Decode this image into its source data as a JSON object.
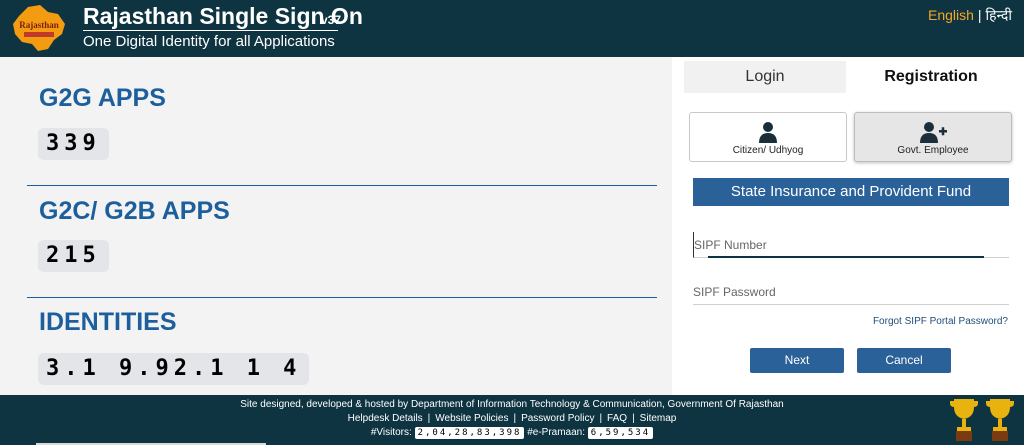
{
  "header": {
    "logo_text": "Rajasthan",
    "title": "Rajasthan Single Sign On",
    "version": "v37",
    "subtitle": "One Digital Identity for all Applications",
    "lang_en": "English",
    "lang_separator": "|",
    "lang_hi": "हिन्दी"
  },
  "stats": [
    {
      "title": "G2G APPS",
      "value": "339"
    },
    {
      "title": "G2C/ G2B APPS",
      "value": "215"
    },
    {
      "title": "IDENTITIES",
      "value": "3.1 9.92.1 1 4"
    }
  ],
  "tabs": {
    "login": "Login",
    "registration": "Registration"
  },
  "user_types": {
    "citizen": "Citizen/ Udhyog",
    "gov": "Govt. Employee"
  },
  "sipf": {
    "heading": "State Insurance and Provident Fund",
    "number_placeholder": "SIPF Number",
    "password_placeholder": "SIPF Password",
    "forgot": "Forgot SIPF Portal Password?"
  },
  "buttons": {
    "next": "Next",
    "cancel": "Cancel"
  },
  "footer": {
    "credit": "Site designed, developed & hosted by Department of Information Technology & Communication, Government Of Rajasthan",
    "links": [
      "Helpdesk Details",
      "Website Policies",
      "Password Policy",
      "FAQ",
      "Sitemap"
    ],
    "link_separator": "|",
    "visitors_label": "#Visitors:",
    "visitors_value": "2,04,28,83,398",
    "epramaan_label": "#e-Pramaan:",
    "epramaan_value": "6,59,534"
  },
  "colors": {
    "header_bg": "#0f3441",
    "accent_blue": "#1c5f9c",
    "button_blue": "#2b6199",
    "lang_active": "#f5a623"
  },
  "icons": [
    "logo-map",
    "user-icon",
    "user-plus-icon",
    "trophy-icon"
  ]
}
